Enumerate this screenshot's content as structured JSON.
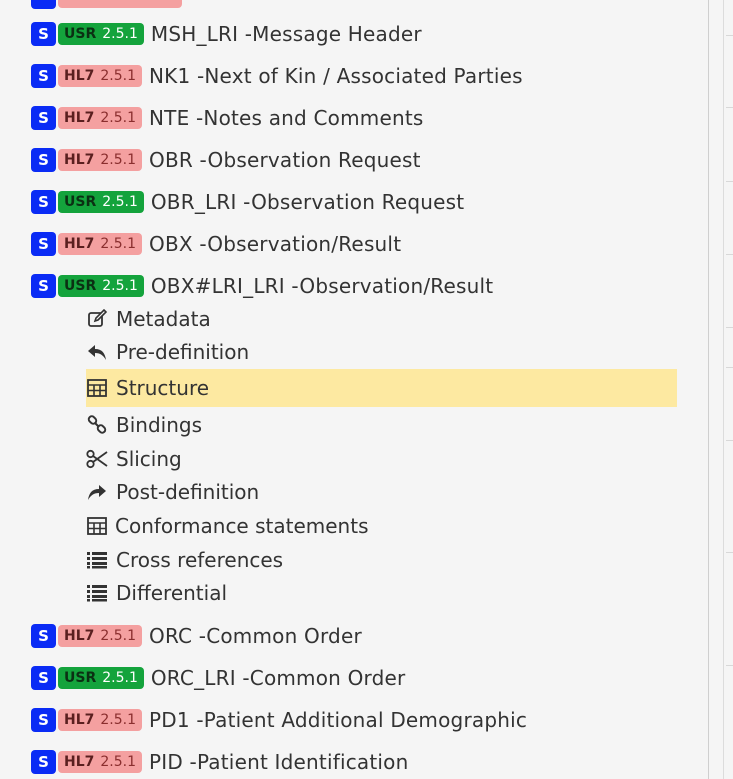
{
  "segments_top": [
    {
      "s": "S",
      "scope": "USR",
      "version": "2.5.1",
      "label": "MSH_LRI -Message Header"
    },
    {
      "s": "S",
      "scope": "HL7",
      "version": "2.5.1",
      "label": "NK1 -Next of Kin / Associated Parties"
    },
    {
      "s": "S",
      "scope": "HL7",
      "version": "2.5.1",
      "label": "NTE -Notes and Comments"
    },
    {
      "s": "S",
      "scope": "HL7",
      "version": "2.5.1",
      "label": "OBR -Observation Request"
    },
    {
      "s": "S",
      "scope": "USR",
      "version": "2.5.1",
      "label": "OBR_LRI -Observation Request"
    },
    {
      "s": "S",
      "scope": "HL7",
      "version": "2.5.1",
      "label": "OBX -Observation/Result"
    },
    {
      "s": "S",
      "scope": "USR",
      "version": "2.5.1",
      "label": "OBX#LRI_LRI -Observation/Result"
    }
  ],
  "submenu": [
    {
      "icon": "edit-icon",
      "label": "Metadata"
    },
    {
      "icon": "reply-icon",
      "label": "Pre-definition"
    },
    {
      "icon": "table-icon",
      "label": "Structure"
    },
    {
      "icon": "link-icon",
      "label": "Bindings"
    },
    {
      "icon": "scissors-icon",
      "label": "Slicing"
    },
    {
      "icon": "share-icon",
      "label": "Post-definition"
    },
    {
      "icon": "table-icon",
      "label": "Conformance statements"
    },
    {
      "icon": "list-icon",
      "label": "Cross references"
    },
    {
      "icon": "list-icon",
      "label": "Differential"
    }
  ],
  "segments_bottom": [
    {
      "s": "S",
      "scope": "HL7",
      "version": "2.5.1",
      "label": "ORC -Common Order"
    },
    {
      "s": "S",
      "scope": "USR",
      "version": "2.5.1",
      "label": "ORC_LRI -Common Order"
    },
    {
      "s": "S",
      "scope": "HL7",
      "version": "2.5.1",
      "label": "PD1 -Patient Additional Demographic"
    },
    {
      "s": "S",
      "scope": "HL7",
      "version": "2.5.1",
      "label": "PID -Patient Identification"
    }
  ],
  "colors": {
    "s_badge": "#0a2bf5",
    "usr_badge": "#14a33c",
    "hl7_badge": "#f4a0a0",
    "selected_bg": "#fde9a1"
  }
}
